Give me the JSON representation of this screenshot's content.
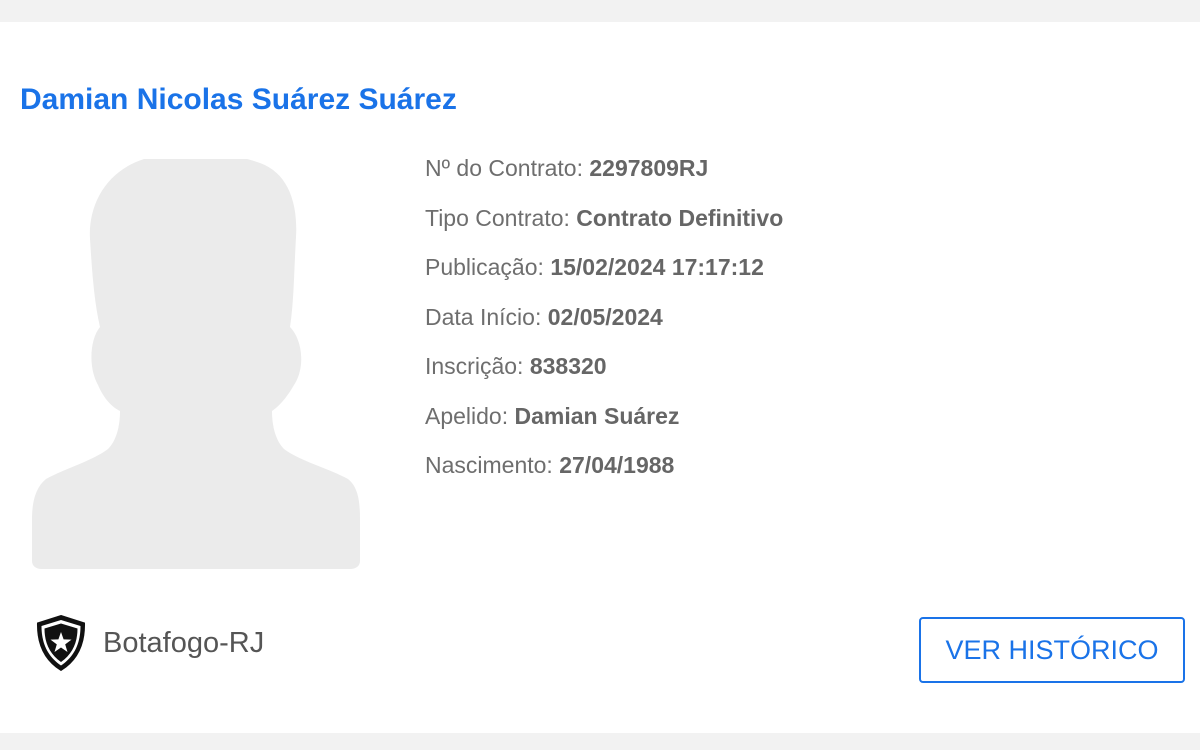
{
  "player": {
    "name": "Damian Nicolas Suárez Suárez"
  },
  "details": [
    {
      "label": "Nº do Contrato:",
      "value": "2297809RJ"
    },
    {
      "label": "Tipo Contrato:",
      "value": "Contrato Definitivo"
    },
    {
      "label": "Publicação:",
      "value": "15/02/2024 17:17:12"
    },
    {
      "label": "Data Início:",
      "value": "02/05/2024"
    },
    {
      "label": "Inscrição:",
      "value": "838320"
    },
    {
      "label": "Apelido:",
      "value": "Damian Suárez"
    },
    {
      "label": "Nascimento:",
      "value": "27/04/1988"
    }
  ],
  "team": {
    "name": "Botafogo-RJ",
    "crest_icon": "botafogo-crest-icon"
  },
  "actions": {
    "history_label": "VER HISTÓRICO"
  },
  "colors": {
    "accent": "#1a73e8",
    "label_text": "#6e6e6e",
    "value_text": "#666666",
    "photo_placeholder": "#ebebeb",
    "page_background": "#f2f2f2"
  },
  "icons": {
    "photo": "avatar-placeholder-icon"
  }
}
